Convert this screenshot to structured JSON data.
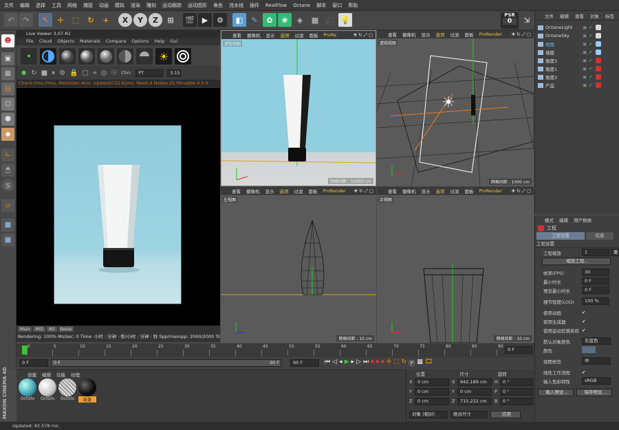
{
  "menubar": {
    "items": [
      "文件",
      "编辑",
      "选择",
      "工具",
      "网格",
      "捕捉",
      "动画",
      "模拟",
      "渲染",
      "雕刻",
      "运动跟踪",
      "运动图形",
      "角色",
      "流水线",
      "插件",
      "RealFlow",
      "Octane",
      "脚本",
      "窗口",
      "帮助"
    ]
  },
  "toolbar": {
    "axis_x": "X",
    "axis_y": "Y",
    "axis_z": "Z",
    "psr_label": "PSR",
    "psr_value": "0"
  },
  "live_viewer": {
    "title": "Live Viewer 3.07-R1",
    "menu": [
      "File",
      "Cloud",
      "Objects",
      "Materials",
      "Compare",
      "Options",
      "Help",
      "Gui"
    ],
    "chn_label": "Chn:",
    "chn_value": "PT",
    "chn_num": "3.15",
    "status": "Check:0ms./0ms. MeshGen:4ms. Update[CG]:92ms. Mesh:4 Nodes:25 Movable:4 0 0",
    "tabs": [
      "Main",
      "MID",
      "AO",
      "Noise"
    ],
    "render_info": "Rendering: 100%   Ms/sec: 0   Time: 小时 : 分钟 : 秒/小时 : 分钟 : 秒   Spp/maxspp: 2000/2000   Tri: 0/2"
  },
  "viewports": {
    "menu": [
      "查看",
      "摄像机",
      "显示",
      "选项",
      "过滤",
      "面板"
    ],
    "renderer": "ProRender",
    "renderer_short": "ProRe",
    "tl": {
      "label": "透视视图",
      "scale": "网格间距 : 10000 cm"
    },
    "tr": {
      "label": "透视视图",
      "scale": "网格间距 : 1000 cm"
    },
    "bl": {
      "label": "左视图",
      "scale": "网格间距 : 10 cm"
    },
    "br": {
      "label": "正视图",
      "scale": "网格间距 : 10 cm"
    }
  },
  "object_manager": {
    "menu": [
      "文件",
      "编辑",
      "查看",
      "对象",
      "标签"
    ],
    "objects": [
      {
        "name": "OctaneLight",
        "color": "#dddddd"
      },
      {
        "name": "OctaneSky",
        "color": "#dddddd"
      },
      {
        "name": "地面",
        "color": "#66b8f0"
      },
      {
        "name": "墙面",
        "color": "#dddddd"
      },
      {
        "name": "角度3",
        "color": "#dddddd"
      },
      {
        "name": "角度1",
        "color": "#dddddd"
      },
      {
        "name": "角度2",
        "color": "#dddddd"
      },
      {
        "name": "产品",
        "color": "#dddddd"
      }
    ]
  },
  "attributes": {
    "menu": [
      "模式",
      "编辑",
      "用户数据"
    ],
    "title": "工程",
    "tabs": [
      "工程设置",
      "信息"
    ],
    "section": "工程设置",
    "scale_label": "工程缩放",
    "scale_value": "1",
    "scale_unit": "厘米",
    "scale_btn": "缩放工程...",
    "fps_label": "帧率(FPS)",
    "fps_value": "30",
    "min_label": "最小时长",
    "min_value": "0 F",
    "preview_min_label": "预览最小时长",
    "preview_min_value": "0 F",
    "lod_label": "细节程度(LOD)",
    "lod_value": "100 %",
    "anim_label": "使用动画",
    "gen_label": "使用生成器",
    "motion_label": "使用运动剪辑系统",
    "default_color_label": "默认对象颜色",
    "default_color_value": "灰蓝色",
    "color_label": "颜色",
    "clip_label": "视图修剪",
    "clip_value": "中",
    "linear_label": "线性工作流程",
    "input_label": "输入色彩特性",
    "input_value": "sRGB",
    "load_btn": "载入预设...",
    "save_btn": "保存预设..."
  },
  "timeline": {
    "ticks": [
      "0",
      "5",
      "10",
      "15",
      "20",
      "25",
      "30",
      "35",
      "40",
      "45",
      "50",
      "55",
      "60",
      "65",
      "70",
      "75",
      "80",
      "85",
      "90"
    ],
    "current": "0 F",
    "start": "0 F",
    "start2": "0 F",
    "end": "90 F",
    "end2": "90 F"
  },
  "materials": {
    "menu": [
      "创建",
      "编辑",
      "功能",
      "纹理"
    ],
    "items": [
      {
        "label": "OctGlo",
        "selected": false
      },
      {
        "label": "OctGlo",
        "selected": false
      },
      {
        "label": "OctGlo",
        "selected": false
      },
      {
        "label": "纸盖",
        "selected": true
      }
    ]
  },
  "coordinates": {
    "headers": [
      "位置",
      "尺寸",
      "旋转"
    ],
    "rows": [
      {
        "axis": "X",
        "pos": "0 cm",
        "size": "942.189 cm",
        "rot_axis": "H",
        "rot": "0 °"
      },
      {
        "axis": "Y",
        "pos": "0 cm",
        "size": "0 cm",
        "rot_axis": "P",
        "rot": "0 °"
      },
      {
        "axis": "Z",
        "pos": "0 cm",
        "size": "715.222 cm",
        "rot_axis": "B",
        "rot": "0 °"
      }
    ],
    "mode": "对象 (相对)",
    "size_mode": "绝对尺寸",
    "apply": "应用"
  },
  "status": "Updated: 92.578 ms.",
  "brand": "MAXON CINEMA 4D"
}
